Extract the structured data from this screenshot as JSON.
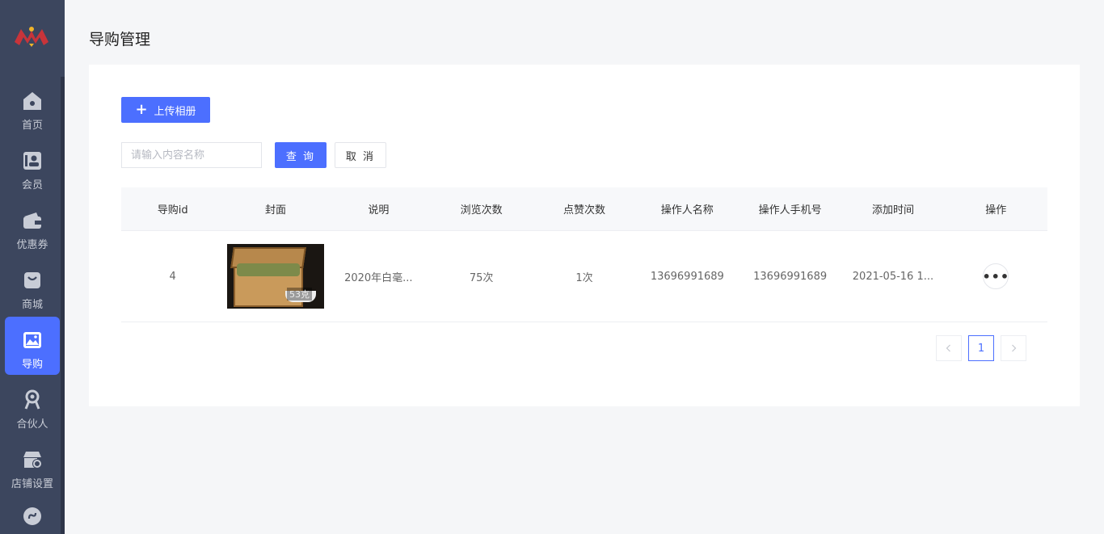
{
  "colors": {
    "sidebar": "#3c465e",
    "accent": "#4c6fff",
    "background": "#f5f6f8"
  },
  "sidebar": {
    "logo": "brand-logo",
    "items": [
      {
        "label": "首页",
        "icon": "home-icon",
        "active": false
      },
      {
        "label": "会员",
        "icon": "member-card-icon",
        "active": false
      },
      {
        "label": "优惠券",
        "icon": "wallet-icon",
        "active": false
      },
      {
        "label": "商城",
        "icon": "shopping-bag-icon",
        "active": false
      },
      {
        "label": "导购",
        "icon": "image-gallery-icon",
        "active": true
      },
      {
        "label": "合伙人",
        "icon": "partner-icon",
        "active": false
      },
      {
        "label": "店铺设置",
        "icon": "store-settings-icon",
        "active": false
      },
      {
        "label": "",
        "icon": "mini-program-icon",
        "active": false
      }
    ]
  },
  "page": {
    "title": "导购管理"
  },
  "toolbar": {
    "upload_label": "上传相册",
    "upload_icon": "plus-icon"
  },
  "search": {
    "placeholder": "请输入内容名称",
    "value": "",
    "query_label": "查 询",
    "cancel_label": "取 消"
  },
  "table": {
    "columns": [
      "导购id",
      "封面",
      "说明",
      "浏览次数",
      "点赞次数",
      "操作人名称",
      "操作人手机号",
      "添加时间",
      "操作"
    ],
    "rows": [
      {
        "id": "4",
        "cover": {
          "tag": "53克"
        },
        "description": "2020年白毫...",
        "views": "75次",
        "likes": "1次",
        "operator_name": "13696991689",
        "operator_phone": "13696991689",
        "added_time": "2021-05-16 1...",
        "action_icon": "more-icon",
        "action_label": "•••"
      }
    ]
  },
  "pagination": {
    "current": "1",
    "prev_icon": "chevron-left-icon",
    "next_icon": "chevron-right-icon"
  }
}
